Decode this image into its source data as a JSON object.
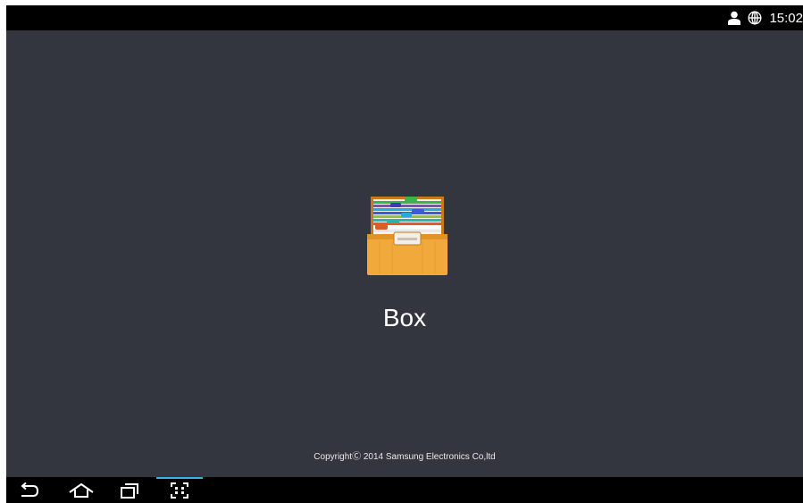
{
  "status_bar": {
    "time": "15:02",
    "icons": [
      "user-icon",
      "globe-icon"
    ]
  },
  "app": {
    "title": "Box",
    "icon": "box-drawer-icon",
    "copyright": "CopyrightⒸ 2014 Samsung Electronics Co,ltd"
  },
  "nav_bar": {
    "buttons": [
      "back-icon",
      "home-icon",
      "recent-apps-icon",
      "screen-capture-icon"
    ],
    "active_accent": "#33b5e5"
  },
  "colors": {
    "background": "#34363f",
    "bars": "#000000"
  }
}
